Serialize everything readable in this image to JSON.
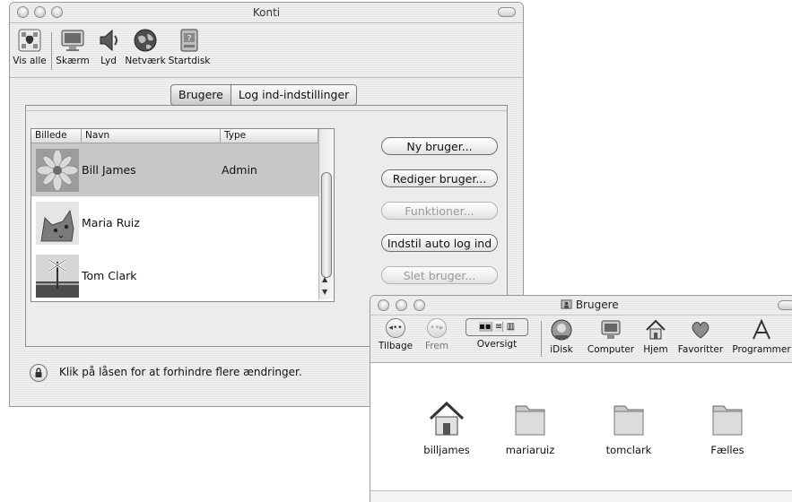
{
  "accounts_window": {
    "title": "Konti",
    "toolbar": [
      {
        "label": "Vis alle",
        "icon": "apple-logo-icon"
      },
      {
        "label": "Skærm",
        "icon": "display-icon"
      },
      {
        "label": "Lyd",
        "icon": "speaker-icon"
      },
      {
        "label": "Netværk",
        "icon": "globe-icon"
      },
      {
        "label": "Startdisk",
        "icon": "hard-disk-icon"
      }
    ],
    "tabs": [
      {
        "label": "Brugere",
        "active": true
      },
      {
        "label": "Log ind-indstillinger",
        "active": false
      }
    ],
    "table": {
      "columns": [
        "Billede",
        "Navn",
        "Type"
      ],
      "rows": [
        {
          "name": "Bill James",
          "type": "Admin",
          "picture": "flower-icon",
          "selected": true
        },
        {
          "name": "Maria Ruiz",
          "type": "",
          "picture": "cat-icon",
          "selected": false
        },
        {
          "name": "Tom Clark",
          "type": "",
          "picture": "railroad-sign-icon",
          "selected": false
        }
      ]
    },
    "buttons": [
      {
        "label": "Ny bruger...",
        "enabled": true
      },
      {
        "label": "Rediger bruger...",
        "enabled": true
      },
      {
        "label": "Funktioner...",
        "enabled": false
      },
      {
        "label": "Indstil auto log ind",
        "enabled": true
      },
      {
        "label": "Slet bruger...",
        "enabled": false
      }
    ],
    "lock_text": "Klik på låsen for at forhindre flere ændringer."
  },
  "finder_window": {
    "title": "Brugere",
    "toolbar": [
      {
        "label": "Tilbage",
        "icon": "back-icon"
      },
      {
        "label": "Frem",
        "icon": "forward-icon"
      },
      {
        "label": "Oversigt",
        "icon": "view-mode-icon"
      },
      {
        "label": "iDisk",
        "icon": "idisk-icon"
      },
      {
        "label": "Computer",
        "icon": "computer-icon"
      },
      {
        "label": "Hjem",
        "icon": "home-icon"
      },
      {
        "label": "Favoritter",
        "icon": "heart-icon"
      },
      {
        "label": "Programmer",
        "icon": "applications-icon"
      }
    ],
    "items": [
      {
        "label": "billjames",
        "icon": "home-folder-icon"
      },
      {
        "label": "mariaruiz",
        "icon": "folder-icon"
      },
      {
        "label": "tomclark",
        "icon": "folder-icon"
      },
      {
        "label": "Fælles",
        "icon": "folder-icon"
      }
    ]
  }
}
